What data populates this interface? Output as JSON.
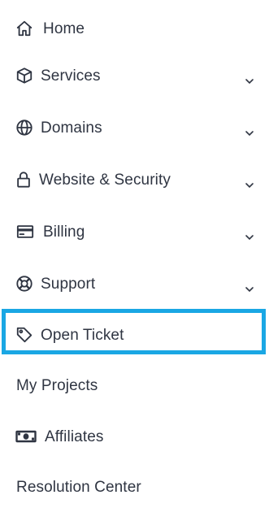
{
  "nav": {
    "items": [
      {
        "label": "Home",
        "icon": "home-icon",
        "has_dropdown": false
      },
      {
        "label": "Services",
        "icon": "cube-icon",
        "has_dropdown": true
      },
      {
        "label": "Domains",
        "icon": "globe-icon",
        "has_dropdown": true
      },
      {
        "label": "Website & Security",
        "icon": "lock-icon",
        "has_dropdown": true
      },
      {
        "label": "Billing",
        "icon": "credit-card-icon",
        "has_dropdown": true
      },
      {
        "label": "Support",
        "icon": "lifebuoy-icon",
        "has_dropdown": true
      },
      {
        "label": "Open Ticket",
        "icon": "tag-icon",
        "has_dropdown": false,
        "highlighted": true
      },
      {
        "label": "My Projects",
        "icon": "",
        "has_dropdown": false
      },
      {
        "label": "Affiliates",
        "icon": "money-icon",
        "has_dropdown": false
      },
      {
        "label": "Resolution Center",
        "icon": "",
        "has_dropdown": false
      }
    ]
  },
  "colors": {
    "text": "#2f3542",
    "highlight_border": "#1aa7e4",
    "background": "#ffffff"
  }
}
